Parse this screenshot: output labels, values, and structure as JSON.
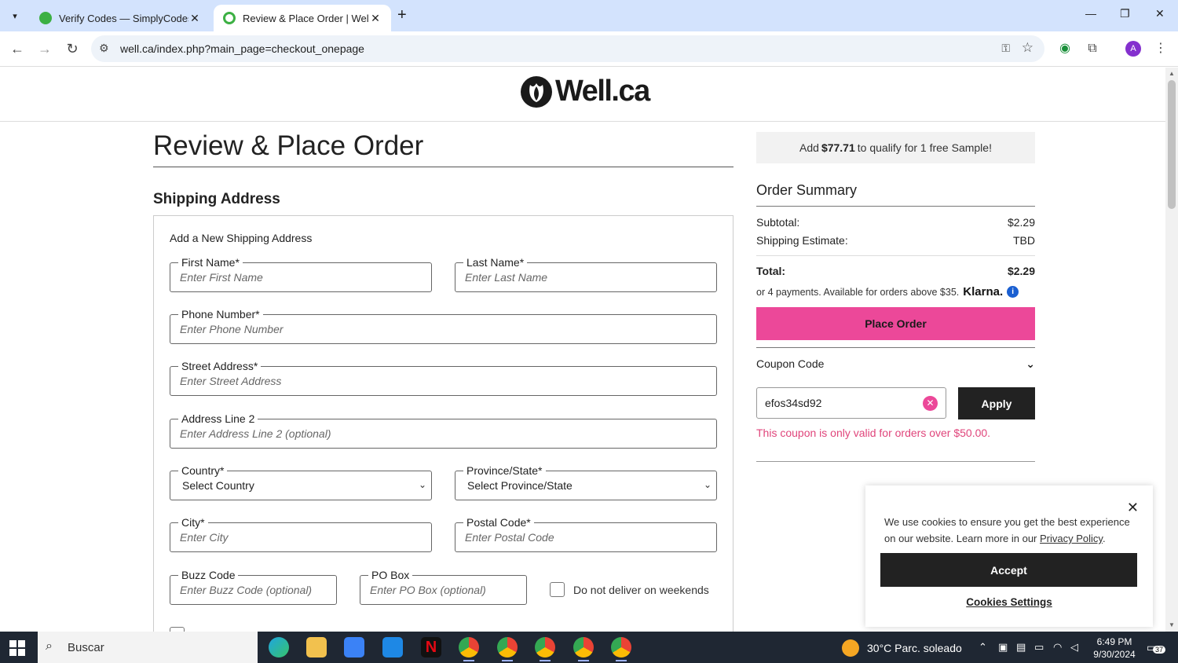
{
  "browser": {
    "tabs": [
      {
        "title": "Verify Codes — SimplyCodes",
        "favicon_color": "#3cb043"
      },
      {
        "title": "Review & Place Order | Well.ca",
        "favicon_color": "#3cb043"
      }
    ],
    "url": "well.ca/index.php?main_page=checkout_onepage",
    "profile_initial": "A"
  },
  "site": {
    "logo_text": "Well.ca"
  },
  "page": {
    "title": "Review & Place Order",
    "shipping_section_title": "Shipping Address",
    "card_heading": "Add a New Shipping Address",
    "fields": {
      "first_name": {
        "label": "First Name*",
        "placeholder": "Enter First Name"
      },
      "last_name": {
        "label": "Last Name*",
        "placeholder": "Enter Last Name"
      },
      "phone": {
        "label": "Phone Number*",
        "placeholder": "Enter Phone Number"
      },
      "street": {
        "label": "Street Address*",
        "placeholder": "Enter Street Address"
      },
      "address2": {
        "label": "Address Line 2",
        "placeholder": "Enter Address Line 2 (optional)"
      },
      "country": {
        "label": "Country*",
        "value": "Select Country"
      },
      "province": {
        "label": "Province/State*",
        "value": "Select Province/State"
      },
      "city": {
        "label": "City*",
        "placeholder": "Enter City"
      },
      "postal": {
        "label": "Postal Code*",
        "placeholder": "Enter Postal Code"
      },
      "buzz": {
        "label": "Buzz Code",
        "placeholder": "Enter Buzz Code (optional)"
      },
      "pobox": {
        "label": "PO Box",
        "placeholder": "Enter PO Box (optional)"
      }
    },
    "weekend_checkbox_label": "Do not deliver on weekends"
  },
  "summary": {
    "promo_prefix": "Add",
    "promo_amount": "$77.71",
    "promo_suffix": "to qualify for 1 free Sample!",
    "title": "Order Summary",
    "subtotal_label": "Subtotal:",
    "subtotal_value": "$2.29",
    "shipping_label": "Shipping Estimate:",
    "shipping_value": "TBD",
    "total_label": "Total:",
    "total_value": "$2.29",
    "klarna_text": "or 4 payments. Available for orders above $35.",
    "klarna_brand": "Klarna.",
    "place_order_label": "Place Order",
    "coupon_label": "Coupon Code",
    "coupon_value": "efos34sd92",
    "apply_label": "Apply",
    "coupon_error": "This coupon is only valid for orders over $50.00."
  },
  "cookie": {
    "text": "We use cookies to ensure you get the best experience on our website. Learn more in our",
    "link": "Privacy Policy",
    "accept": "Accept",
    "settings": "Cookies Settings"
  },
  "taskbar": {
    "search_placeholder": "Buscar",
    "weather": "30°C  Parc. soleado",
    "time": "6:49 PM",
    "date": "9/30/2024",
    "notifications": "37"
  },
  "colors": {
    "accent_pink": "#ec4899",
    "error_pink": "#e0457b",
    "dark_button": "#222222",
    "tabbar_bg": "#d3e3fd"
  }
}
